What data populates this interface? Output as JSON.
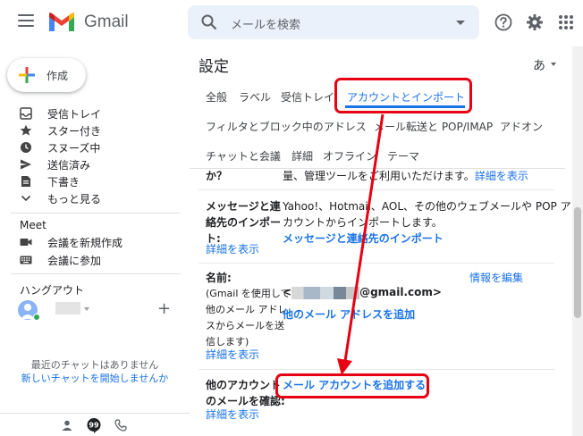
{
  "header": {
    "app_name": "Gmail",
    "search_placeholder": "メールを検索"
  },
  "sidebar": {
    "compose_label": "作成",
    "items": [
      {
        "label": "受信トレイ",
        "icon": "inbox-icon"
      },
      {
        "label": "スター付き",
        "icon": "star-icon"
      },
      {
        "label": "スヌーズ中",
        "icon": "clock-icon"
      },
      {
        "label": "送信済み",
        "icon": "send-icon"
      },
      {
        "label": "下書き",
        "icon": "draft-icon"
      },
      {
        "label": "もっと見る",
        "icon": "chevron-down-icon"
      }
    ],
    "meet": {
      "title": "Meet",
      "items": [
        {
          "label": "会議を新規作成",
          "icon": "video-icon"
        },
        {
          "label": "会議に参加",
          "icon": "keyboard-icon"
        }
      ]
    },
    "hangouts": {
      "title": "ハングアウト",
      "no_chats": "最近のチャットはありません",
      "start_chat": "新しいチャットを開始しませんか"
    }
  },
  "main": {
    "title": "設定",
    "language": "あ",
    "tabs_row1": [
      "全般",
      "ラベル",
      "受信トレイ",
      "アカウントとインポート"
    ],
    "tabs_row2": [
      "フィルタとブロック中のアドレス",
      "メール転送と POP/IMAP",
      "アドオン"
    ],
    "tabs_row3": [
      "チャットと会議",
      "詳細",
      "オフライン",
      "テーマ"
    ],
    "rows": {
      "partial_label": "か？",
      "partial_text": "量、管理ツールをご利用いただけます。",
      "partial_link": "詳細を表示",
      "import_label": [
        "メッセージと連",
        "絡先のインポー",
        "ト:"
      ],
      "import_text": [
        "Yahoo!、Hotmail、AOL、その他のウェブメールや POP ア",
        "カウントからインポートします。"
      ],
      "import_link": "メッセージと連絡先のインポート",
      "import_detail": "詳細を表示",
      "name_label": "名前:",
      "name_desc": [
        "(Gmail を使用して",
        "他のメール アドレ",
        "スからメールを送",
        "信します)"
      ],
      "name_detail": "詳細を表示",
      "name_email_prefix": "<",
      "name_email": "@gmail.com>",
      "name_edit": "情報を編集",
      "add_other_address": "他のメール アドレスを追加",
      "check_label": [
        "他のアカウント",
        "のメールを確認:"
      ],
      "check_link": "メール アカウントを追加する",
      "check_detail": "詳細を表示"
    }
  },
  "colors": {
    "highlight": "#e60012",
    "link": "#1a73e8",
    "search_bg": "#eaf1fb"
  }
}
